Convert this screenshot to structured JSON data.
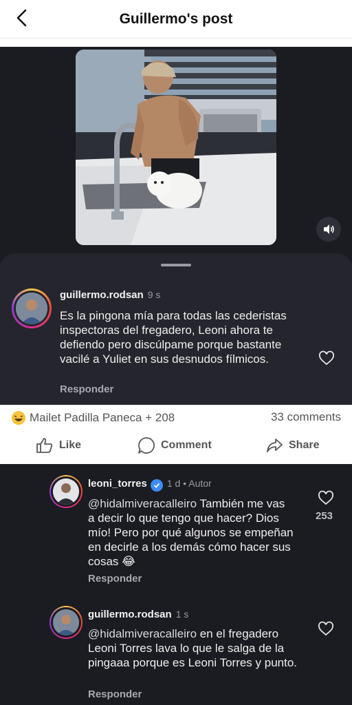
{
  "header": {
    "title": "Guillermo's post"
  },
  "post": {
    "comment": {
      "username": "guillermo.rodsan",
      "time": "9 s",
      "text": "Es la pingona mía para todas las cederistas inspectoras del fregadero, Leoni ahora te defiendo pero discúlpame porque bastante vacilé a Yuliet en sus desnudos fílmicos.",
      "reply": "Responder"
    }
  },
  "fb": {
    "reactions": "Mailet Padilla Paneca + 208",
    "comments_count": "33 comments",
    "actions": [
      {
        "label": "Like"
      },
      {
        "label": "Comment"
      },
      {
        "label": "Share"
      }
    ]
  },
  "replies": [
    {
      "username": "leoni_torres",
      "meta": "1 d • Autor",
      "mention": "@hidalmiveracalleiro",
      "text": "También me vas a decir lo que tengo que hacer? Dios mío! Pero por qué algunos se empeñan en decirle a los demás cómo hacer sus cosas 😂",
      "reply": "Responder",
      "likes": "253"
    },
    {
      "username": "guillermo.rodsan",
      "meta": "1 s",
      "mention": "@hidalmiveracalleiro",
      "text": "en el fregadero Leoni Torres lava lo que le salga de la pingaaa porque es Leoni Torres y punto.",
      "reply": "Responder"
    }
  ],
  "icons": {
    "back": "chevron-left-icon",
    "mute": "speaker-icon",
    "heart": "heart-outline-icon",
    "verified": "verified-badge-icon",
    "reaction": "laughing-emoji-icon"
  },
  "colors": {
    "dark_bg": "#1b1c22",
    "sheet_bg": "#25262d",
    "verified": "#3d8bf5"
  }
}
